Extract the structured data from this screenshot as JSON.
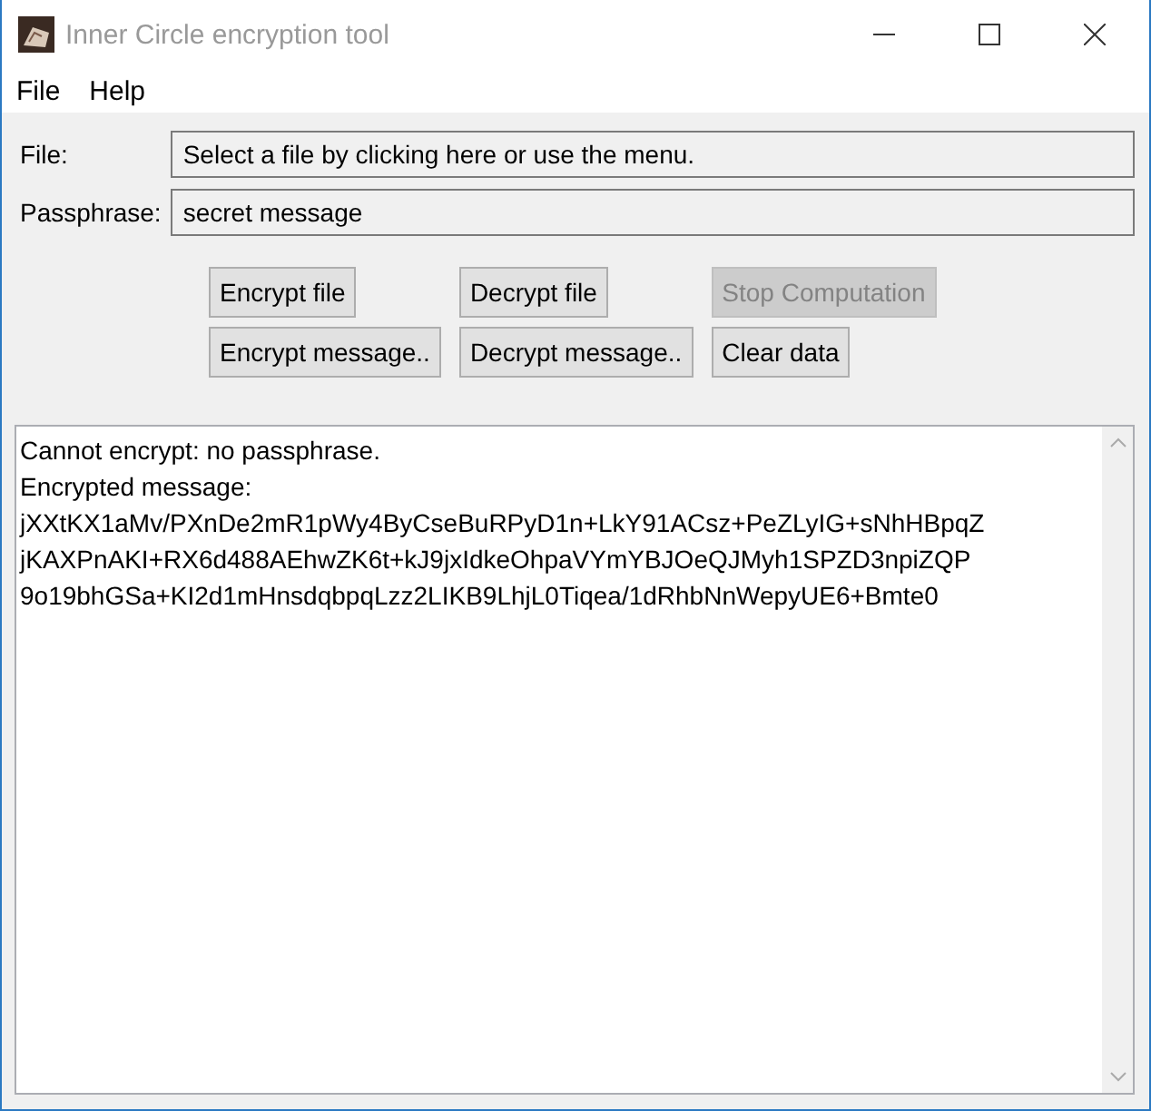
{
  "window": {
    "title": "Inner Circle encryption tool"
  },
  "menu": [
    "File",
    "Help"
  ],
  "fields": [
    {
      "label": "File:",
      "placeholder": "Select a file by clicking here or use the menu."
    },
    {
      "label": "Passphrase:",
      "value": "secret message"
    }
  ],
  "buttons": [
    {
      "label": "Encrypt file",
      "disabled": false
    },
    {
      "label": "Decrypt file",
      "disabled": false
    },
    {
      "label": "Stop Computation",
      "disabled": true
    },
    {
      "label": "Encrypt message..",
      "disabled": false
    },
    {
      "label": "Decrypt message..",
      "disabled": false
    },
    {
      "label": "Clear data",
      "disabled": false
    }
  ],
  "output": [
    "Cannot encrypt: no passphrase.",
    "Encrypted message:",
    "jXXtKX1aMv/PXnDe2mR1pWy4ByCseBuRPyD1n+LkY91ACsz+PeZLyIG+sNhHBpqZ",
    "jKAXPnAKI+RX6d488AEhwZK6t+kJ9jxIdkeOhpaVYmYBJOeQJMyh1SPZD3npiZQP",
    "9o19bhGSa+KI2d1mHnsdqbpqLzz2LIKB9LhjL0Tiqea/1dRhbNnWepyUE6+Bmte0"
  ]
}
